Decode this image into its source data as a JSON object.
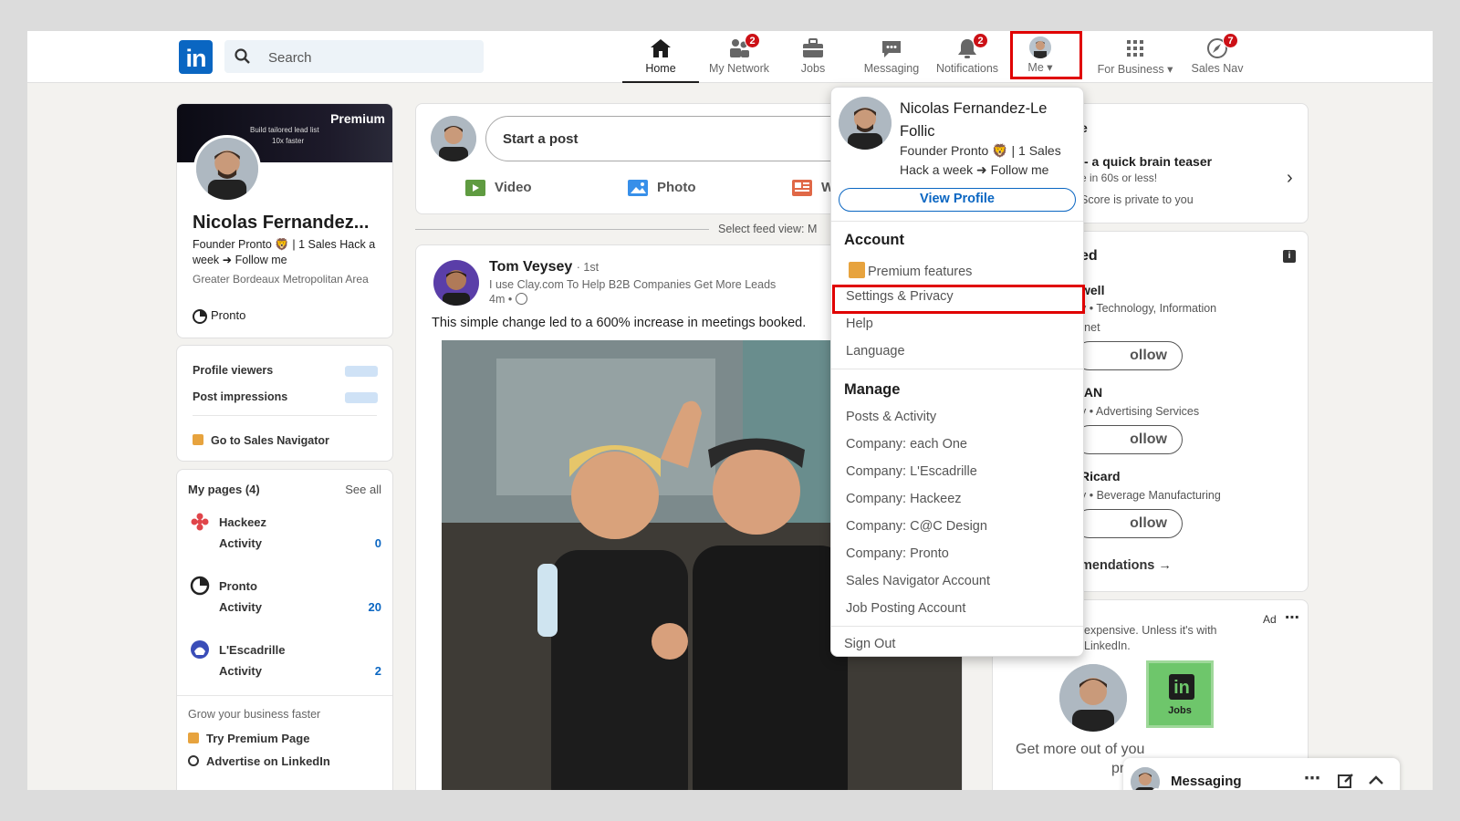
{
  "nav": {
    "search_placeholder": "Search",
    "items": [
      {
        "label": "Home"
      },
      {
        "label": "My Network",
        "badge": "2"
      },
      {
        "label": "Jobs"
      },
      {
        "label": "Messaging"
      },
      {
        "label": "Notifications",
        "badge": "2"
      },
      {
        "label": "Me"
      },
      {
        "label": "For Business"
      },
      {
        "label": "Sales Nav",
        "badge": "7"
      }
    ]
  },
  "profile": {
    "banner_title": "Premium",
    "banner_line1": "Build tailored lead list",
    "banner_line2": "10x faster",
    "name": "Nicolas Fernandez...",
    "headline": "Founder Pronto 🦁 | 1 Sales Hack a week ➜ Follow me",
    "location": "Greater Bordeaux Metropolitan Area",
    "company": "Pronto"
  },
  "stats": {
    "profile_viewers": "Profile viewers",
    "post_impressions": "Post impressions",
    "sales_nav_link": "Go to Sales Navigator"
  },
  "pages": {
    "title": "My pages (4)",
    "see_all": "See all",
    "items": [
      {
        "name": "Hackeez",
        "activity": "Activity",
        "count": "0"
      },
      {
        "name": "Pronto",
        "activity": "Activity",
        "count": "20"
      },
      {
        "name": "L'Escadrille",
        "activity": "Activity",
        "count": "2"
      }
    ],
    "grow": "Grow your business faster",
    "try_premium": "Try Premium Page",
    "advertise": "Advertise on LinkedIn"
  },
  "share": {
    "placeholder": "Start a post",
    "video": "Video",
    "photo": "Photo",
    "write_partial": "W"
  },
  "feed_view": "Select feed view: M",
  "post": {
    "author": "Tom Veysey",
    "degree": "· 1st",
    "headline": "I use Clay.com To Help B2B Companies Get More Leads",
    "time": "4m •",
    "text": "This simple change led to a 600% increase in meetings booked."
  },
  "right": {
    "puzzle_title_partial": "e",
    "puzzle_line": "- a quick brain teaser",
    "puzzle_sub": "e in 60s or less!",
    "puzzle_private": "Score is private to you",
    "follow_title_partial": "ed",
    "people": [
      {
        "name_partial": "well",
        "desc_partial": "y • Technology, Information",
        "desc2_partial": "rnet"
      },
      {
        "name_partial": "IAN",
        "desc_partial": "y • Advertising Services"
      },
      {
        "name_partial": "Ricard",
        "desc_partial": "y • Beverage Manufacturing"
      }
    ],
    "follow_partial": "ollow",
    "recommendations_partial": "mendations →",
    "ad_label": "Ad",
    "ad_text1": "expensive. Unless it's with",
    "ad_text2": "LinkedIn.",
    "jobs_label": "Jobs",
    "ad_bottom1": "Get more out of you",
    "ad_bottom2": "pricir"
  },
  "dropdown": {
    "name": "Nicolas Fernandez-Le Follic",
    "headline": "Founder Pronto 🦁 | 1 Sales Hack a week ➜ Follow me",
    "view_profile": "View Profile",
    "account_title": "Account",
    "account_items": [
      "Premium features",
      "Settings & Privacy",
      "Help",
      "Language"
    ],
    "manage_title": "Manage",
    "manage_items": [
      "Posts & Activity",
      "Company: each One",
      "Company: L'Escadrille",
      "Company: Hackeez",
      "Company: C@C Design",
      "Company: Pronto",
      "Sales Navigator Account",
      "Job Posting Account"
    ],
    "sign_out": "Sign Out"
  },
  "messaging": {
    "title": "Messaging"
  },
  "colors": {
    "brand": "#0a66c2",
    "badge": "#cc1016",
    "highlight": "#e00000",
    "premium": "#e7a33e"
  }
}
